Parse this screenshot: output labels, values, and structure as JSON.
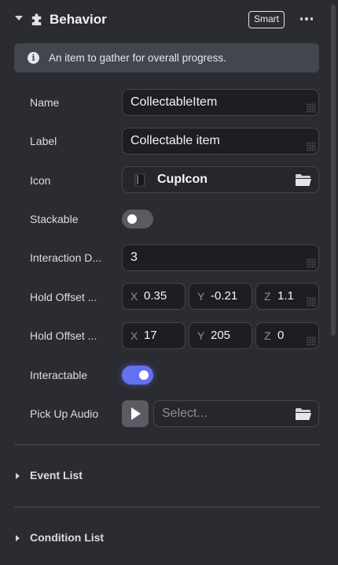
{
  "header": {
    "title": "Behavior",
    "badge": "Smart"
  },
  "info": {
    "text": "An item to gather for overall progress."
  },
  "fields": {
    "name": {
      "label": "Name",
      "value": "CollectableItem"
    },
    "label": {
      "label": "Label",
      "value": "Collectable item"
    },
    "icon": {
      "label": "Icon",
      "value": "CupIcon"
    },
    "stackable": {
      "label": "Stackable",
      "checked": false
    },
    "interaction_distance": {
      "label": "Interaction D...",
      "value": "3"
    },
    "hold_offset_position": {
      "label": "Hold Offset ...",
      "x": "0.35",
      "y": "-0.21",
      "z": "1.1"
    },
    "hold_offset_rotation": {
      "label": "Hold Offset ...",
      "x": "17",
      "y": "205",
      "z": "0"
    },
    "interactable": {
      "label": "Interactable",
      "checked": true
    },
    "pick_up_audio": {
      "label": "Pick Up Audio",
      "placeholder": "Select..."
    }
  },
  "axes": {
    "x": "X",
    "y": "Y",
    "z": "Z"
  },
  "sections": [
    {
      "label": "Event List"
    },
    {
      "label": "Condition List"
    }
  ],
  "colors": {
    "accent": "#6470f2",
    "panel": "#2b2c31",
    "field": "#1d1e22"
  }
}
